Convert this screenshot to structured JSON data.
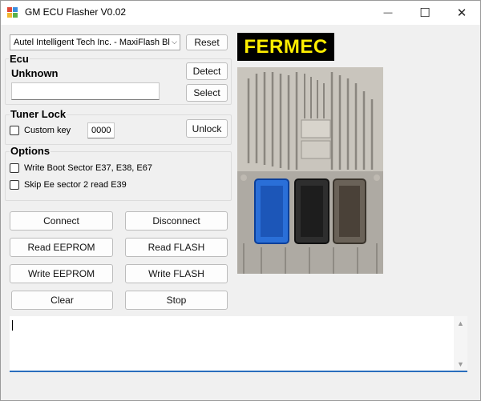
{
  "window": {
    "title": "GM ECU Flasher V0.02",
    "minimize_glyph": "—",
    "maximize_glyph": "☐",
    "close_glyph": "✕"
  },
  "interface_select": {
    "value": "Autel Intelligent Tech Inc. - MaxiFlash Bl",
    "arrow": "⌵"
  },
  "buttons": {
    "reset": "Reset",
    "detect": "Detect",
    "select": "Select",
    "unlock": "Unlock",
    "connect": "Connect",
    "disconnect": "Disconnect",
    "read_eeprom": "Read  EEPROM",
    "read_flash": "Read  FLASH",
    "write_eeprom": "Write  EEPROM",
    "write_flash": "Write  FLASH",
    "clear": "Clear",
    "stop": "Stop"
  },
  "ecu_group": {
    "label": "Ecu",
    "status": "Unknown",
    "field_value": ""
  },
  "tuner_lock": {
    "label": "Tuner Lock",
    "custom_key_label": "Custom key",
    "custom_key_checked": false,
    "key_value": "0000"
  },
  "options": {
    "label": "Options",
    "write_boot_label": "Write Boot Sector E37, E38, E67",
    "write_boot_checked": false,
    "skip_ee_label": "Skip Ee sector 2 read E39",
    "skip_ee_checked": false
  },
  "brand": {
    "text": "FERMEC",
    "bg_color": "#000000",
    "text_color": "#ffee00"
  },
  "log": {
    "content": ""
  },
  "scroll": {
    "up": "▲",
    "down": "▼"
  }
}
